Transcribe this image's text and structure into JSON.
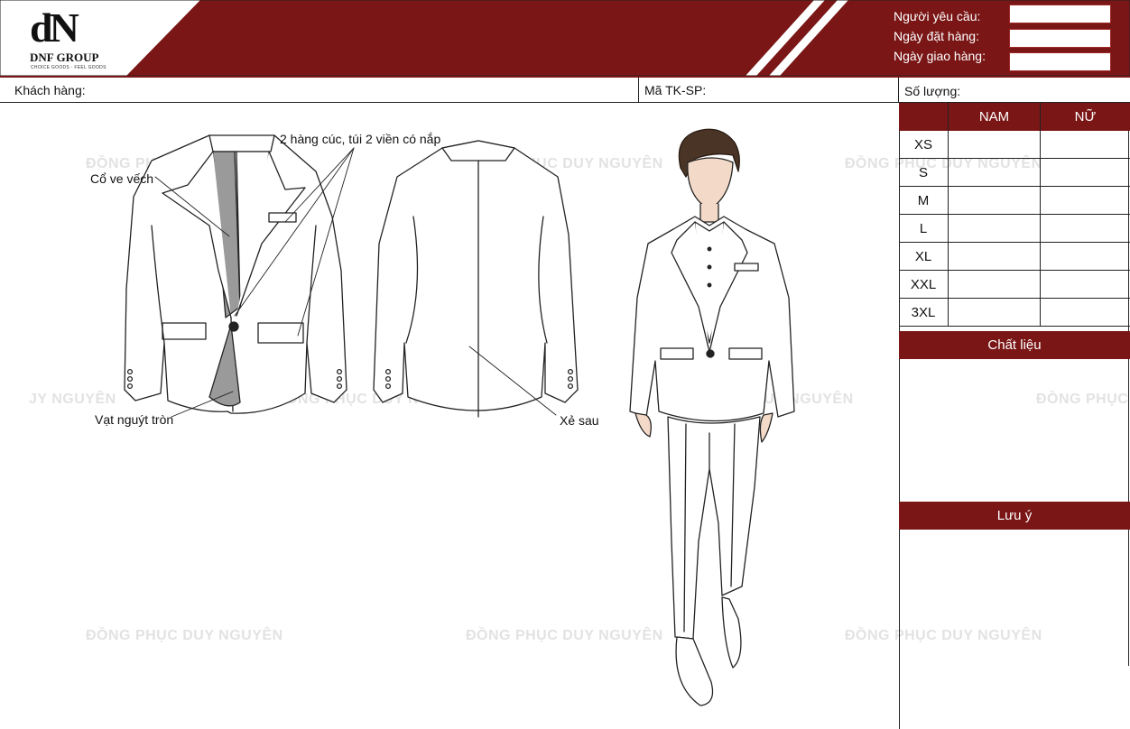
{
  "brand": {
    "mark": "dN",
    "name": "DNF GROUP",
    "tagline": "CHOICE GOODS - FEEL GOODS"
  },
  "colors": {
    "accent": "#7a1616",
    "header_band": "#7a1616"
  },
  "request": {
    "requester_label": "Người yêu cầu:",
    "order_date_label": "Ngày đặt hàng:",
    "delivery_date_label": "Ngày giao hàng:",
    "requester_value": "",
    "order_date_value": "",
    "delivery_date_value": ""
  },
  "info": {
    "customer_label": "Khách hàng:",
    "code_label": "Mã TK-SP:",
    "quantity_label": "Số lượng:"
  },
  "sizes": {
    "headers": [
      "",
      "NAM",
      "NỮ"
    ],
    "rows": [
      "XS",
      "S",
      "M",
      "L",
      "XL",
      "XXL",
      "3XL"
    ]
  },
  "sections": {
    "material": "Chất liệu",
    "notes": "Lưu ý"
  },
  "annotations": {
    "buttons_pockets": "2 hàng cúc, túi 2 viền có nắp",
    "collar": "Cổ ve vếch",
    "hem": "Vạt nguýt tròn",
    "back_vent": "Xẻ sau"
  },
  "watermark": "ĐỒNG PHỤC DUY NGUYÊN",
  "watermark_partial_left": "JY NGUYÊN",
  "watermark_partial_right": "ĐỒNG PHỤC"
}
